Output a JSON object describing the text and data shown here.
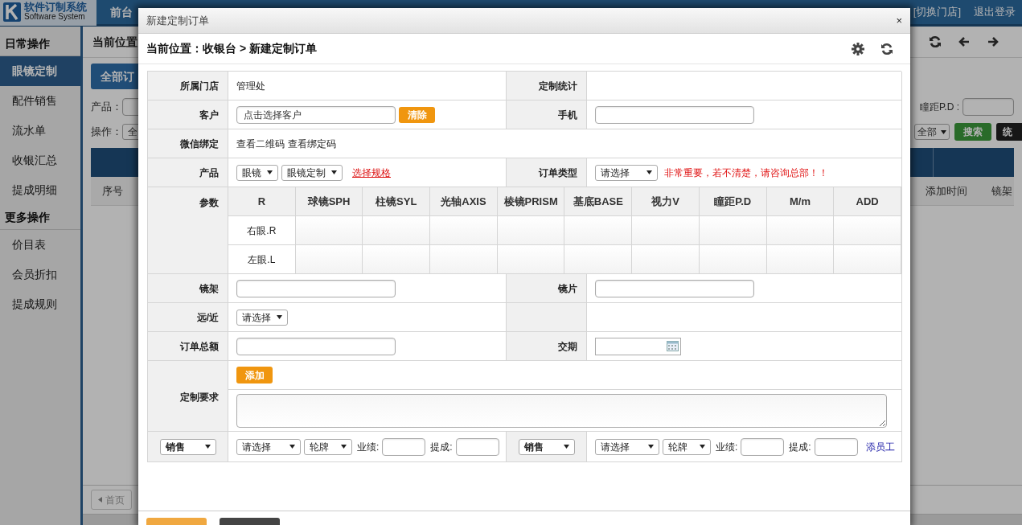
{
  "background": {
    "logo": {
      "title": "软件订制系统",
      "subtitle": "Software System"
    },
    "top_nav": "前台",
    "header_links": [
      "[切换门店]",
      "退出登录"
    ],
    "sidebar": [
      {
        "kind": "header",
        "label": "日常操作"
      },
      {
        "kind": "item",
        "label": "眼镜定制",
        "selected": true
      },
      {
        "kind": "item",
        "label": "配件销售",
        "selected": false
      },
      {
        "kind": "item",
        "label": "流水单",
        "selected": false
      },
      {
        "kind": "item",
        "label": "收银汇总",
        "selected": false
      },
      {
        "kind": "item",
        "label": "提成明细",
        "selected": false
      },
      {
        "kind": "header",
        "label": "更多操作"
      },
      {
        "kind": "item",
        "label": "价目表",
        "selected": false
      },
      {
        "kind": "item",
        "label": "会员折扣",
        "selected": false
      },
      {
        "kind": "item",
        "label": "提成规则",
        "selected": false
      }
    ],
    "breadcrumb": "当前位置",
    "tab_button": "全部订",
    "filters": {
      "product_label": "产品：",
      "operation_label": "操作：",
      "operation_value": "全",
      "pd_label": "瞳距P.D :",
      "status_select": "全部",
      "search_button": "搜索",
      "stats_button": "统"
    },
    "table_columns": [
      "序号",
      "添加时间",
      "镜架"
    ],
    "pager": "首页"
  },
  "modal": {
    "title": "新建定制订单",
    "close": "×",
    "breadcrumb": "当前位置：收银台 > 新建定制订单",
    "store": {
      "label": "所属门店",
      "value": "管理处"
    },
    "stats": {
      "label": "定制统计"
    },
    "customer": {
      "label": "客户",
      "placeholder": "点击选择客户",
      "clear_button": "清除"
    },
    "phone": {
      "label": "手机"
    },
    "wechat": {
      "label": "微信绑定",
      "links": [
        "查看二维码",
        "查看绑定码"
      ]
    },
    "product": {
      "label": "产品",
      "selects": [
        "眼镜",
        "眼镜定制"
      ],
      "spec_link": "选择规格"
    },
    "order_type": {
      "label": "订单类型",
      "select": "请选择",
      "warning": "非常重要，若不清楚，请咨询总部！！"
    },
    "params": {
      "label": "参数",
      "columns": [
        "R",
        "球镜SPH",
        "柱镜SYL",
        "光轴AXIS",
        "棱镜PRISM",
        "基底BASE",
        "视力V",
        "瞳距P.D",
        "M/m",
        "ADD"
      ],
      "rows": [
        "右眼.R",
        "左眼.L"
      ]
    },
    "frame": {
      "label": "镜架"
    },
    "lens": {
      "label": "镜片"
    },
    "distance": {
      "label": "远/近",
      "select": "请选择"
    },
    "total": {
      "label": "订单总额"
    },
    "delivery": {
      "label": "交期"
    },
    "requirement": {
      "label": "定制要求",
      "add_button": "添加"
    },
    "staff": [
      {
        "role": "销售",
        "staff": "请选择",
        "rotation": "轮牌",
        "performance_label": "业绩:",
        "commission_label": "提成:"
      },
      {
        "role": "销售",
        "staff": "请选择",
        "rotation": "轮牌",
        "performance_label": "业绩:",
        "commission_label": "提成:"
      }
    ],
    "add_staff_link": "添员工"
  }
}
